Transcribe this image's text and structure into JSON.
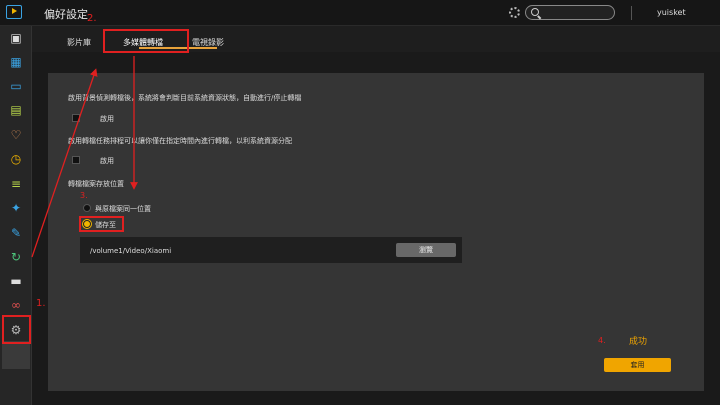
{
  "app": {
    "title": "偏好設定",
    "user": "yuisket"
  },
  "colors": {
    "accent": "#f0a500",
    "annotation": "#e02020",
    "logo": "#3aa3e3"
  },
  "sidebar": {
    "items": [
      {
        "icon": "dashboard-icon",
        "color": "#dddddd"
      },
      {
        "icon": "film-icon",
        "color": "#3aa3e3"
      },
      {
        "icon": "tv-icon",
        "color": "#3aa3e3"
      },
      {
        "icon": "collection-icon",
        "color": "#b8d64a"
      },
      {
        "icon": "heart-icon",
        "color": "#e9975a"
      },
      {
        "icon": "clock-icon",
        "color": "#f0b400"
      },
      {
        "icon": "list-icon",
        "color": "#b8d64a"
      },
      {
        "icon": "pin-icon",
        "color": "#3aa3e3"
      },
      {
        "icon": "satellite-icon",
        "color": "#3aa3e3"
      },
      {
        "icon": "refresh-icon",
        "color": "#4cc37a"
      },
      {
        "icon": "folder-icon",
        "color": "#dddddd"
      },
      {
        "icon": "record-icon",
        "color": "#e05050"
      },
      {
        "icon": "gear-icon",
        "color": "#bbbbbb"
      }
    ]
  },
  "tabs": [
    {
      "label": "影片庫"
    },
    {
      "label": "多媒體轉檔"
    },
    {
      "label": "電視錄影"
    }
  ],
  "panel": {
    "auto_desc": "啟用背景偵測轉檔後，系統將會判斷目前系統資源狀態，自動進行/停止轉檔",
    "auto_check": "啟用",
    "schedule_desc": "啟用轉檔任務排程可以讓你僅在指定時間內進行轉檔，以利系統資源分配",
    "schedule_check": "啟用",
    "location_label": "轉檔檔案存放位置",
    "radio_same": "與原檔案同一位置",
    "radio_save": "儲存至",
    "path": "/volume1/Video/Xiaomi",
    "browse": "瀏覽",
    "apply": "套用"
  },
  "annotations": {
    "step1": "1.",
    "step2": "2.",
    "step3": "3.",
    "step4": "4.",
    "success": "成功"
  }
}
